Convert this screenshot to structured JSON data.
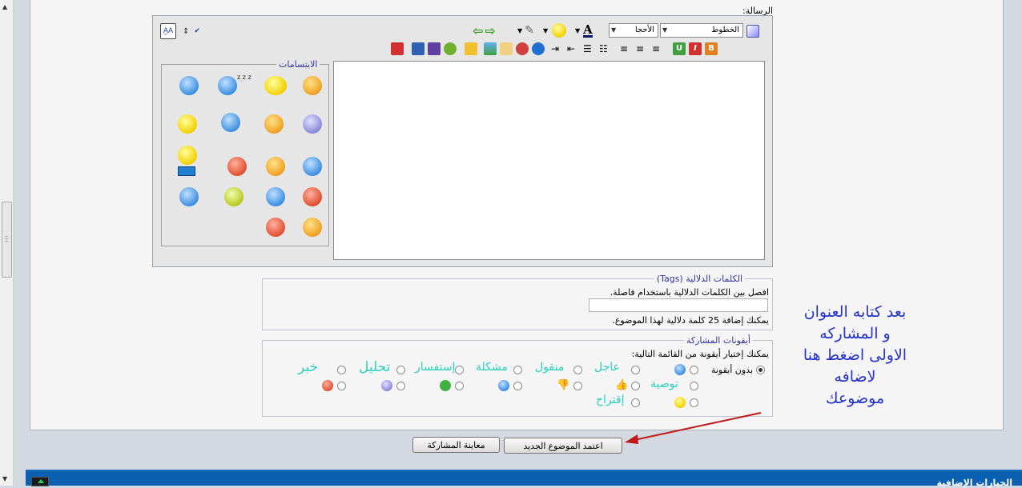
{
  "message_label": "الرسالة:",
  "toolbar": {
    "font_select": "الخطوط",
    "size_select": "الأحجا"
  },
  "smilies": {
    "legend": "الابتسامات",
    "zzz": "z z z"
  },
  "tags": {
    "legend": "الكلمات الدلالية (Tags)",
    "instruction": "افصل بين الكلمات الدلالية باستخدام فاصلة.",
    "input_value": "",
    "limit_note": "يمكنك إضافة 25 كلمة دلالية لهذا الموضوع."
  },
  "post_icons": {
    "legend": "أيقونات المشاركة",
    "instruction": "يمكنك إختيار أيقونة من القائمة التالية:",
    "no_icon": "بدون أيقونة",
    "words": {
      "urgent": "عاجل",
      "transferred": "منقول",
      "problem": "مشكلة",
      "inquiry": "إستفسار",
      "analysis": "تحليل",
      "news": "خبر",
      "recommendation": "توصية",
      "suggestion": "إقتراح"
    }
  },
  "buttons": {
    "submit": "اعتمد الموضوع الجديد",
    "preview": "معاينة المشاركة"
  },
  "annotation": {
    "line1": "بعد كتابه العنوان",
    "line2": "و المشاركه",
    "line3": "الاولى اضغط هنا",
    "line4": "لاضافه",
    "line5": "موضوعك"
  },
  "additional_options": {
    "title": "الخيارات الإضافية"
  },
  "colors": {
    "accent_blue": "#0b5fb0",
    "annotation_blue": "#2433c8",
    "arrow_red": "#c01818",
    "icon_word_cyan": "#2ad0c0"
  }
}
